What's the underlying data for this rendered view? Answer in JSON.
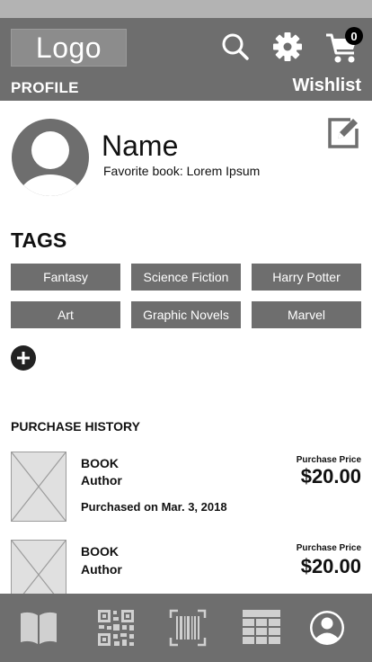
{
  "header": {
    "logo": "Logo",
    "cart_count": "0",
    "profile_tab": "PROFILE",
    "wishlist_tab": "Wishlist"
  },
  "profile": {
    "name": "Name",
    "favorite_book": "Favorite book: Lorem Ipsum"
  },
  "tags": {
    "heading": "TAGS",
    "items": [
      "Fantasy",
      "Science Fiction",
      "Harry Potter",
      "Art",
      "Graphic Novels",
      "Marvel"
    ]
  },
  "purchase_history": {
    "heading": "PURCHASE HISTORY",
    "items": [
      {
        "title": "BOOK",
        "author": "Author",
        "purchased_on": "Purchased on Mar. 3, 2018",
        "price_label": "Purchase Price",
        "price": "$20.00"
      },
      {
        "title": "BOOK",
        "author": "Author",
        "price_label": "Purchase Price",
        "price": "$20.00"
      }
    ]
  },
  "bottom_nav": {
    "items": [
      "book-icon",
      "qr-code-icon",
      "barcode-scan-icon",
      "grid-icon",
      "profile-icon"
    ]
  },
  "colors": {
    "header_bg": "#6e6e6e",
    "tag_bg": "#6e6e6e",
    "status_bar": "#b3b3b3"
  }
}
